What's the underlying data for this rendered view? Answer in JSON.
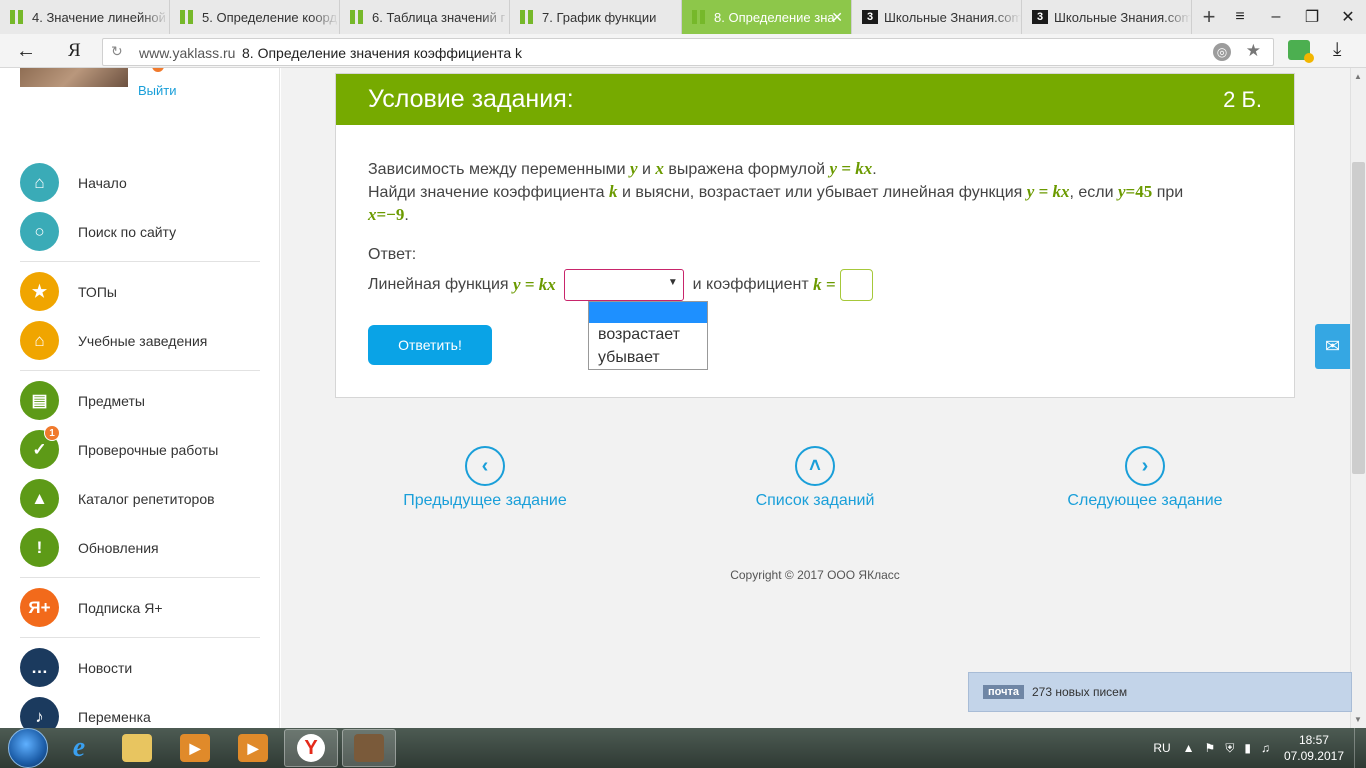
{
  "browser": {
    "tabs": [
      {
        "label": "4. Значение линейной",
        "icon": "yaklass",
        "active": false,
        "w": 170
      },
      {
        "label": "5. Определение коорд",
        "icon": "yaklass",
        "active": false,
        "w": 170
      },
      {
        "label": "6. Таблица значений г",
        "icon": "yaklass",
        "active": false,
        "w": 170
      },
      {
        "label": "7. График функции",
        "icon": "yaklass",
        "active": false,
        "w": 172
      },
      {
        "label": "8. Определение зна",
        "icon": "yaklass",
        "active": true,
        "w": 170
      },
      {
        "label": "Школьные Знания.com",
        "icon": "znanija",
        "active": false,
        "w": 170
      },
      {
        "label": "Школьные Знания.com",
        "icon": "znanija",
        "active": false,
        "w": 170
      }
    ],
    "url_host": "www.yaklass.ru",
    "page_title": "8. Определение значения коэффициента k",
    "yandex_logo": "Я"
  },
  "sidebar": {
    "logout": "Выйти",
    "items": [
      {
        "label": "Начало",
        "icon": "home-icon",
        "color": "#3aabb7",
        "glyph": "⌂"
      },
      {
        "label": "Поиск по сайту",
        "icon": "search-icon",
        "color": "#3aabb7",
        "glyph": "○",
        "sep_after": true
      },
      {
        "label": "ТОПы",
        "icon": "star-icon",
        "color": "#f0a500",
        "glyph": "★"
      },
      {
        "label": "Учебные заведения",
        "icon": "school-icon",
        "color": "#f0a500",
        "glyph": "⌂",
        "sep_after": true
      },
      {
        "label": "Предметы",
        "icon": "book-icon",
        "color": "#5d9a17",
        "glyph": "▤"
      },
      {
        "label": "Проверочные работы",
        "icon": "check-icon",
        "color": "#5d9a17",
        "glyph": "✓",
        "badge": "1"
      },
      {
        "label": "Каталог репетиторов",
        "icon": "graduation-cap-icon",
        "color": "#5d9a17",
        "glyph": "▲"
      },
      {
        "label": "Обновления",
        "icon": "exclamation-icon",
        "color": "#5d9a17",
        "glyph": "!",
        "sep_after": true
      },
      {
        "label": "Подписка Я+",
        "icon": "ya-plus-icon",
        "color": "#f26a1b",
        "glyph": "Я+",
        "sep_after": true
      },
      {
        "label": "Новости",
        "icon": "chat-icon",
        "color": "#1b3a5e",
        "glyph": "…"
      },
      {
        "label": "Переменка",
        "icon": "bell-icon",
        "color": "#1b3a5e",
        "glyph": "♪"
      }
    ]
  },
  "task": {
    "header": "Условие задания:",
    "points": "2 Б.",
    "q1_text": "Зависимость между переменными",
    "q1_y": "y",
    "q1_and": "и",
    "q1_x": "x",
    "q1_rest": "выражена формулой",
    "q1_formula": "y = kx",
    "q2_text": "Найди значение коэффициента",
    "q2_k": "k",
    "q2_mid": "и выясни, возрастает или убывает линейная функция",
    "q2_formula": "y = kx",
    "q2_if": ", если",
    "q2_y": "y",
    "q2_yval": "=45",
    "q2_at": "при",
    "q3_x": "x",
    "q3_xval": "=−9",
    "answer_label": "Ответ:",
    "answer_func": "Линейная функция",
    "answer_formula": "y = kx",
    "answer_and": "и  коэффициент",
    "answer_k": "k =",
    "select_value": "",
    "options": [
      "",
      "возрастает",
      "убывает"
    ],
    "submit": "Ответить!"
  },
  "navigation": {
    "prev": "Предыдущее задание",
    "list": "Список заданий",
    "next": "Следующее задание"
  },
  "footer": {
    "copyright": "Copyright © 2017 ООО ЯКласс"
  },
  "mail_notification": {
    "tag": "почта",
    "text": "273 новых писем"
  },
  "taskbar": {
    "lang": "RU",
    "time": "18:57",
    "date": "07.09.2017"
  }
}
